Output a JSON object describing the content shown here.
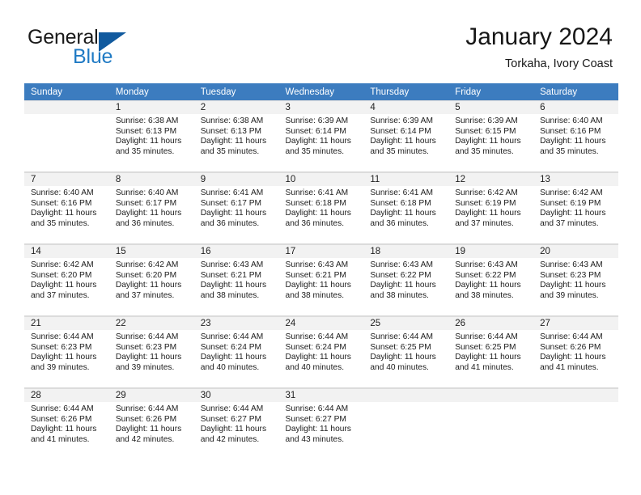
{
  "brand": {
    "name_part1": "General",
    "name_part2": "Blue",
    "triangle_color": "#115a9e",
    "blue_color": "#1f7ac4"
  },
  "header": {
    "title": "January 2024",
    "subtitle": "Torkaha, Ivory Coast"
  },
  "theme": {
    "header_row_bg": "#3c7cbf",
    "daynum_bg": "#f2f2f2",
    "text_color": "#1c1c1c"
  },
  "calendar": {
    "weekday_headers": [
      "Sunday",
      "Monday",
      "Tuesday",
      "Wednesday",
      "Thursday",
      "Friday",
      "Saturday"
    ],
    "labels": {
      "sunrise_prefix": "Sunrise: ",
      "sunset_prefix": "Sunset: ",
      "daylight_prefix": "Daylight: "
    },
    "weeks": [
      [
        {
          "day": "",
          "blank": true
        },
        {
          "day": "1",
          "sunrise": "Sunrise: 6:38 AM",
          "sunset": "Sunset: 6:13 PM",
          "daylight_l1": "Daylight: 11 hours",
          "daylight_l2": "and 35 minutes."
        },
        {
          "day": "2",
          "sunrise": "Sunrise: 6:38 AM",
          "sunset": "Sunset: 6:13 PM",
          "daylight_l1": "Daylight: 11 hours",
          "daylight_l2": "and 35 minutes."
        },
        {
          "day": "3",
          "sunrise": "Sunrise: 6:39 AM",
          "sunset": "Sunset: 6:14 PM",
          "daylight_l1": "Daylight: 11 hours",
          "daylight_l2": "and 35 minutes."
        },
        {
          "day": "4",
          "sunrise": "Sunrise: 6:39 AM",
          "sunset": "Sunset: 6:14 PM",
          "daylight_l1": "Daylight: 11 hours",
          "daylight_l2": "and 35 minutes."
        },
        {
          "day": "5",
          "sunrise": "Sunrise: 6:39 AM",
          "sunset": "Sunset: 6:15 PM",
          "daylight_l1": "Daylight: 11 hours",
          "daylight_l2": "and 35 minutes."
        },
        {
          "day": "6",
          "sunrise": "Sunrise: 6:40 AM",
          "sunset": "Sunset: 6:16 PM",
          "daylight_l1": "Daylight: 11 hours",
          "daylight_l2": "and 35 minutes."
        }
      ],
      [
        {
          "day": "7",
          "sunrise": "Sunrise: 6:40 AM",
          "sunset": "Sunset: 6:16 PM",
          "daylight_l1": "Daylight: 11 hours",
          "daylight_l2": "and 35 minutes."
        },
        {
          "day": "8",
          "sunrise": "Sunrise: 6:40 AM",
          "sunset": "Sunset: 6:17 PM",
          "daylight_l1": "Daylight: 11 hours",
          "daylight_l2": "and 36 minutes."
        },
        {
          "day": "9",
          "sunrise": "Sunrise: 6:41 AM",
          "sunset": "Sunset: 6:17 PM",
          "daylight_l1": "Daylight: 11 hours",
          "daylight_l2": "and 36 minutes."
        },
        {
          "day": "10",
          "sunrise": "Sunrise: 6:41 AM",
          "sunset": "Sunset: 6:18 PM",
          "daylight_l1": "Daylight: 11 hours",
          "daylight_l2": "and 36 minutes."
        },
        {
          "day": "11",
          "sunrise": "Sunrise: 6:41 AM",
          "sunset": "Sunset: 6:18 PM",
          "daylight_l1": "Daylight: 11 hours",
          "daylight_l2": "and 36 minutes."
        },
        {
          "day": "12",
          "sunrise": "Sunrise: 6:42 AM",
          "sunset": "Sunset: 6:19 PM",
          "daylight_l1": "Daylight: 11 hours",
          "daylight_l2": "and 37 minutes."
        },
        {
          "day": "13",
          "sunrise": "Sunrise: 6:42 AM",
          "sunset": "Sunset: 6:19 PM",
          "daylight_l1": "Daylight: 11 hours",
          "daylight_l2": "and 37 minutes."
        }
      ],
      [
        {
          "day": "14",
          "sunrise": "Sunrise: 6:42 AM",
          "sunset": "Sunset: 6:20 PM",
          "daylight_l1": "Daylight: 11 hours",
          "daylight_l2": "and 37 minutes."
        },
        {
          "day": "15",
          "sunrise": "Sunrise: 6:42 AM",
          "sunset": "Sunset: 6:20 PM",
          "daylight_l1": "Daylight: 11 hours",
          "daylight_l2": "and 37 minutes."
        },
        {
          "day": "16",
          "sunrise": "Sunrise: 6:43 AM",
          "sunset": "Sunset: 6:21 PM",
          "daylight_l1": "Daylight: 11 hours",
          "daylight_l2": "and 38 minutes."
        },
        {
          "day": "17",
          "sunrise": "Sunrise: 6:43 AM",
          "sunset": "Sunset: 6:21 PM",
          "daylight_l1": "Daylight: 11 hours",
          "daylight_l2": "and 38 minutes."
        },
        {
          "day": "18",
          "sunrise": "Sunrise: 6:43 AM",
          "sunset": "Sunset: 6:22 PM",
          "daylight_l1": "Daylight: 11 hours",
          "daylight_l2": "and 38 minutes."
        },
        {
          "day": "19",
          "sunrise": "Sunrise: 6:43 AM",
          "sunset": "Sunset: 6:22 PM",
          "daylight_l1": "Daylight: 11 hours",
          "daylight_l2": "and 38 minutes."
        },
        {
          "day": "20",
          "sunrise": "Sunrise: 6:43 AM",
          "sunset": "Sunset: 6:23 PM",
          "daylight_l1": "Daylight: 11 hours",
          "daylight_l2": "and 39 minutes."
        }
      ],
      [
        {
          "day": "21",
          "sunrise": "Sunrise: 6:44 AM",
          "sunset": "Sunset: 6:23 PM",
          "daylight_l1": "Daylight: 11 hours",
          "daylight_l2": "and 39 minutes."
        },
        {
          "day": "22",
          "sunrise": "Sunrise: 6:44 AM",
          "sunset": "Sunset: 6:23 PM",
          "daylight_l1": "Daylight: 11 hours",
          "daylight_l2": "and 39 minutes."
        },
        {
          "day": "23",
          "sunrise": "Sunrise: 6:44 AM",
          "sunset": "Sunset: 6:24 PM",
          "daylight_l1": "Daylight: 11 hours",
          "daylight_l2": "and 40 minutes."
        },
        {
          "day": "24",
          "sunrise": "Sunrise: 6:44 AM",
          "sunset": "Sunset: 6:24 PM",
          "daylight_l1": "Daylight: 11 hours",
          "daylight_l2": "and 40 minutes."
        },
        {
          "day": "25",
          "sunrise": "Sunrise: 6:44 AM",
          "sunset": "Sunset: 6:25 PM",
          "daylight_l1": "Daylight: 11 hours",
          "daylight_l2": "and 40 minutes."
        },
        {
          "day": "26",
          "sunrise": "Sunrise: 6:44 AM",
          "sunset": "Sunset: 6:25 PM",
          "daylight_l1": "Daylight: 11 hours",
          "daylight_l2": "and 41 minutes."
        },
        {
          "day": "27",
          "sunrise": "Sunrise: 6:44 AM",
          "sunset": "Sunset: 6:26 PM",
          "daylight_l1": "Daylight: 11 hours",
          "daylight_l2": "and 41 minutes."
        }
      ],
      [
        {
          "day": "28",
          "sunrise": "Sunrise: 6:44 AM",
          "sunset": "Sunset: 6:26 PM",
          "daylight_l1": "Daylight: 11 hours",
          "daylight_l2": "and 41 minutes."
        },
        {
          "day": "29",
          "sunrise": "Sunrise: 6:44 AM",
          "sunset": "Sunset: 6:26 PM",
          "daylight_l1": "Daylight: 11 hours",
          "daylight_l2": "and 42 minutes."
        },
        {
          "day": "30",
          "sunrise": "Sunrise: 6:44 AM",
          "sunset": "Sunset: 6:27 PM",
          "daylight_l1": "Daylight: 11 hours",
          "daylight_l2": "and 42 minutes."
        },
        {
          "day": "31",
          "sunrise": "Sunrise: 6:44 AM",
          "sunset": "Sunset: 6:27 PM",
          "daylight_l1": "Daylight: 11 hours",
          "daylight_l2": "and 43 minutes."
        },
        {
          "day": "",
          "blank": true
        },
        {
          "day": "",
          "blank": true
        },
        {
          "day": "",
          "blank": true
        }
      ]
    ]
  }
}
